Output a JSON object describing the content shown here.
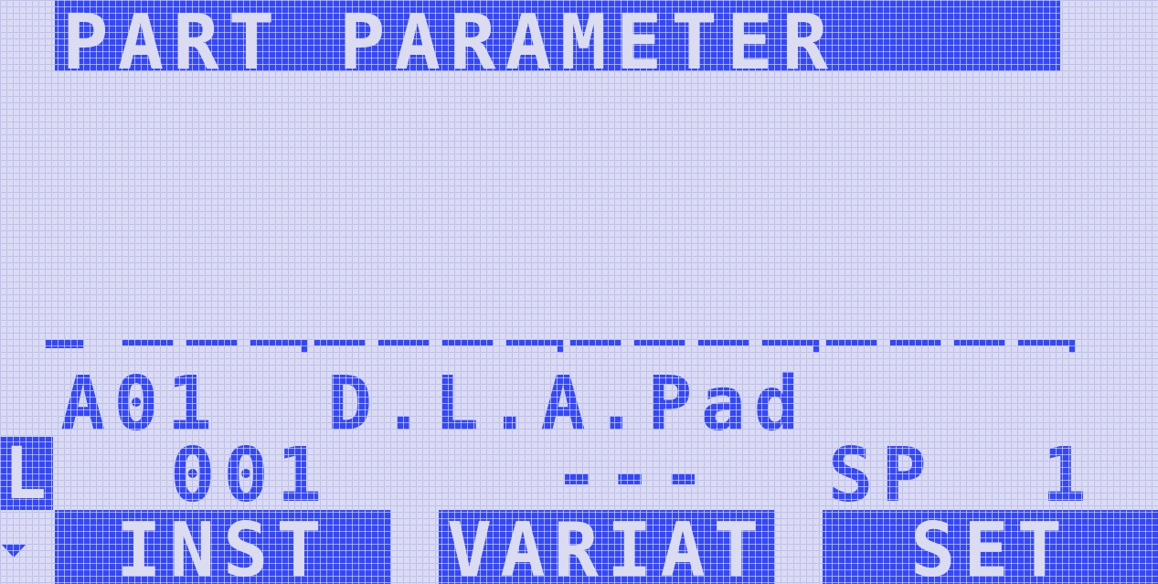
{
  "screen": {
    "title": "PART PARAMETER"
  },
  "part": {
    "instrument": "A01  D.L.A.Pad",
    "part_indicator": "L",
    "number": "001",
    "variation": "---",
    "setting": "SP  1"
  },
  "softkeys": {
    "inst": "INST",
    "variat": "VARIAT",
    "set": "SET"
  },
  "icons": {
    "scroll": "scroll-down-icon"
  },
  "colors": {
    "lcd_background": "#dcdcf0",
    "lcd_ink": "#3347ff"
  }
}
